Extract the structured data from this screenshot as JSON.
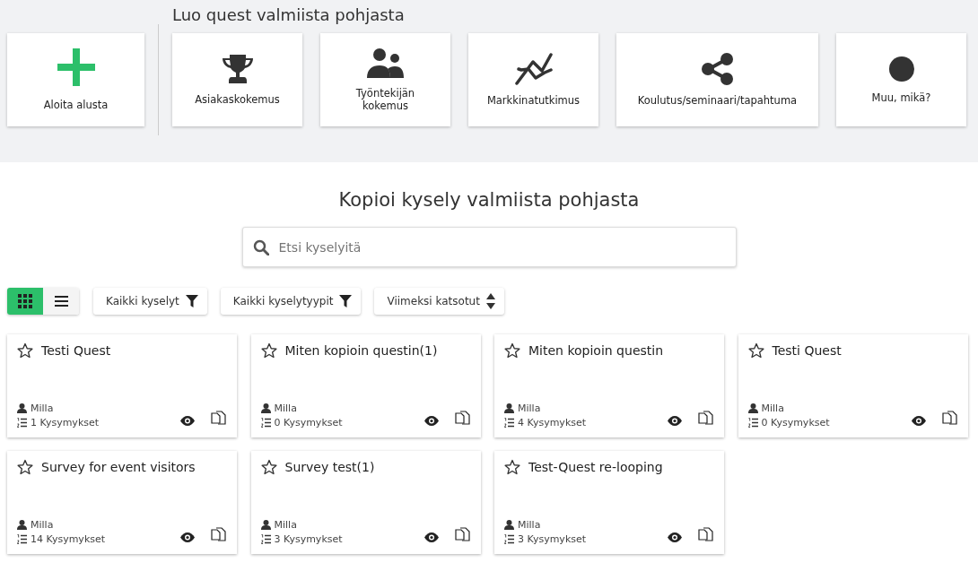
{
  "templates_section": {
    "title": "Luo quest valmiista pohjasta",
    "start": {
      "label": "Aloita alusta",
      "kind": "plus"
    },
    "templates": [
      {
        "label": "Asiakaskokemus",
        "kind": "trophy"
      },
      {
        "label": "Työntekijän kokemus",
        "kind": "people"
      },
      {
        "label": "Markkinatutkimus",
        "kind": "chart"
      },
      {
        "label": "Koulutus/seminaari/tapahtuma",
        "kind": "share"
      },
      {
        "label": "Muu, mikä?",
        "kind": "circle"
      }
    ]
  },
  "copy_section": {
    "title": "Kopioi kysely valmiista pohjasta",
    "search": {
      "placeholder": "Etsi kyselyitä"
    },
    "view_toggle": [
      {
        "kind": "grid",
        "selected": true
      },
      {
        "kind": "list",
        "selected": false
      }
    ],
    "filters": [
      {
        "label": "Kaikki kyselyt",
        "kind": "filter"
      },
      {
        "label": "Kaikki kyselytyypit",
        "kind": "filter"
      },
      {
        "label": "Viimeksi katsotut",
        "kind": "sort"
      }
    ],
    "surveys": [
      {
        "title": "Testi Quest",
        "author": "Milla",
        "questions": "1 Kysymykset",
        "starred": false
      },
      {
        "title": "Miten kopioin questin(1)",
        "author": "Milla",
        "questions": "0 Kysymykset",
        "starred": false
      },
      {
        "title": "Miten kopioin questin",
        "author": "Milla",
        "questions": "4 Kysymykset",
        "starred": false
      },
      {
        "title": "Testi Quest",
        "author": "Milla",
        "questions": "0 Kysymykset",
        "starred": false
      },
      {
        "title": "Survey for event visitors",
        "author": "Milla",
        "questions": "14 Kysymykset",
        "starred": false
      },
      {
        "title": "Survey test(1)",
        "author": "Milla",
        "questions": "3 Kysymykset",
        "starred": false
      },
      {
        "title": "Test-Quest re-looping",
        "author": "Milla",
        "questions": "3 Kysymykset",
        "starred": false
      }
    ]
  }
}
